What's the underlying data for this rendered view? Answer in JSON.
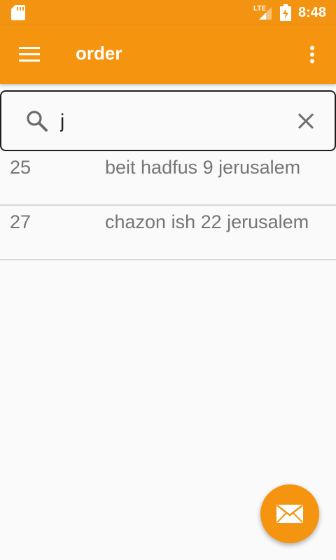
{
  "status_bar": {
    "network_label": "LTE",
    "time": "8:48",
    "icons": [
      "sd-card-icon",
      "signal-icon",
      "battery-charging-icon"
    ]
  },
  "app_bar": {
    "title": "order",
    "menu_icon": "menu-icon",
    "overflow_icon": "more-vert-icon"
  },
  "search": {
    "value": "j",
    "search_icon": "search-icon",
    "clear_icon": "close-icon"
  },
  "results": [
    {
      "number": "25",
      "address": "beit hadfus 9 jerusalem"
    },
    {
      "number": "27",
      "address": "chazon ish 22 jerusalem"
    }
  ],
  "fab": {
    "icon": "mail-icon"
  },
  "colors": {
    "primary": "#f5940f",
    "status_bar": "#f39312",
    "text_secondary": "#757575",
    "background": "#fafafa"
  }
}
